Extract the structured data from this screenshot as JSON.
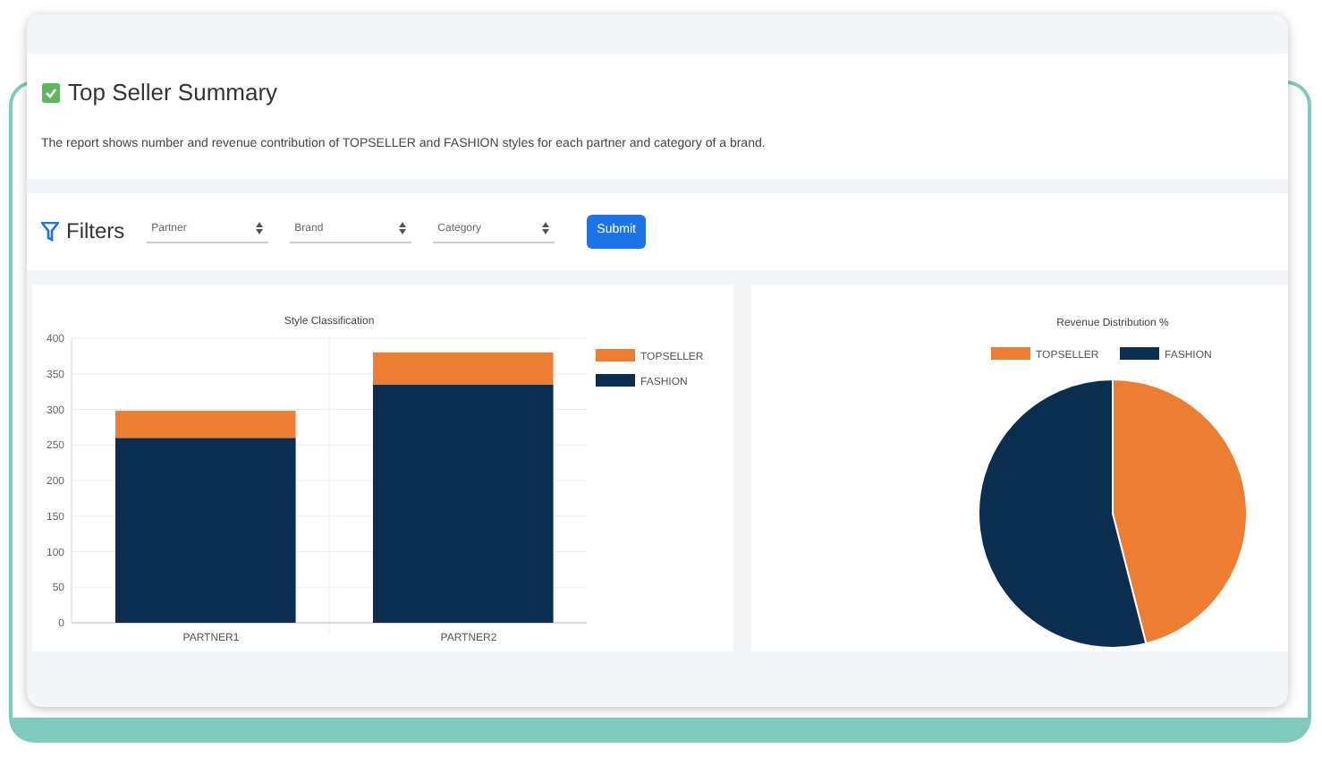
{
  "header": {
    "title": "Top Seller Summary",
    "description": "The report shows number and revenue contribution of TOPSELLER and FASHION styles for each partner and category of a brand."
  },
  "filters": {
    "label": "Filters",
    "selects": [
      {
        "placeholder": "Partner"
      },
      {
        "placeholder": "Brand"
      },
      {
        "placeholder": "Category"
      }
    ],
    "submit": "Submit"
  },
  "bar_chart": {
    "chart_data": {
      "type": "bar",
      "title": "Style Classification",
      "categories": [
        "PARTNER1",
        "PARTNER2"
      ],
      "stacked": true,
      "series": [
        {
          "name": "FASHION",
          "color": "#0b2d4f",
          "values": [
            260,
            335
          ]
        },
        {
          "name": "TOPSELLER",
          "color": "#ed7d31",
          "values": [
            38,
            45
          ]
        }
      ],
      "ylim": [
        0,
        400
      ],
      "yticks": [
        0,
        50,
        100,
        150,
        200,
        250,
        300,
        350,
        400
      ],
      "grid": true,
      "legend": true
    }
  },
  "pie_chart": {
    "title": "Revenue Distribution %",
    "legend": [
      {
        "label": "TOPSELLER",
        "color": "#ed7d31"
      },
      {
        "label": "FASHION",
        "color": "#0b2d4f"
      }
    ]
  }
}
